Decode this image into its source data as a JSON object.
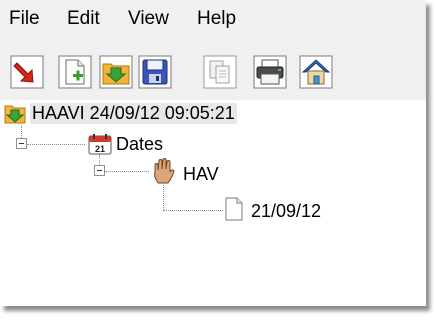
{
  "menu": {
    "file": "File",
    "edit": "Edit",
    "view": "View",
    "help": "Help"
  },
  "toolbar": {
    "buttons": [
      {
        "icon": "red-arrow-icon"
      },
      {
        "icon": "new-document-icon"
      },
      {
        "icon": "open-folder-icon"
      },
      {
        "icon": "save-disk-icon"
      },
      {
        "icon": "copy-icon"
      },
      {
        "icon": "printer-icon"
      },
      {
        "icon": "home-icon"
      }
    ]
  },
  "tree": {
    "root": {
      "label": "HAAVI 24/09/12 09:05:21",
      "icon": "folder-arrow-icon"
    },
    "dates": {
      "label": "Dates",
      "icon": "calendar-icon",
      "calendar_day": "21"
    },
    "hav": {
      "label": "HAV",
      "icon": "hand-icon"
    },
    "leaf": {
      "label": "21/09/12",
      "icon": "document-icon"
    }
  }
}
